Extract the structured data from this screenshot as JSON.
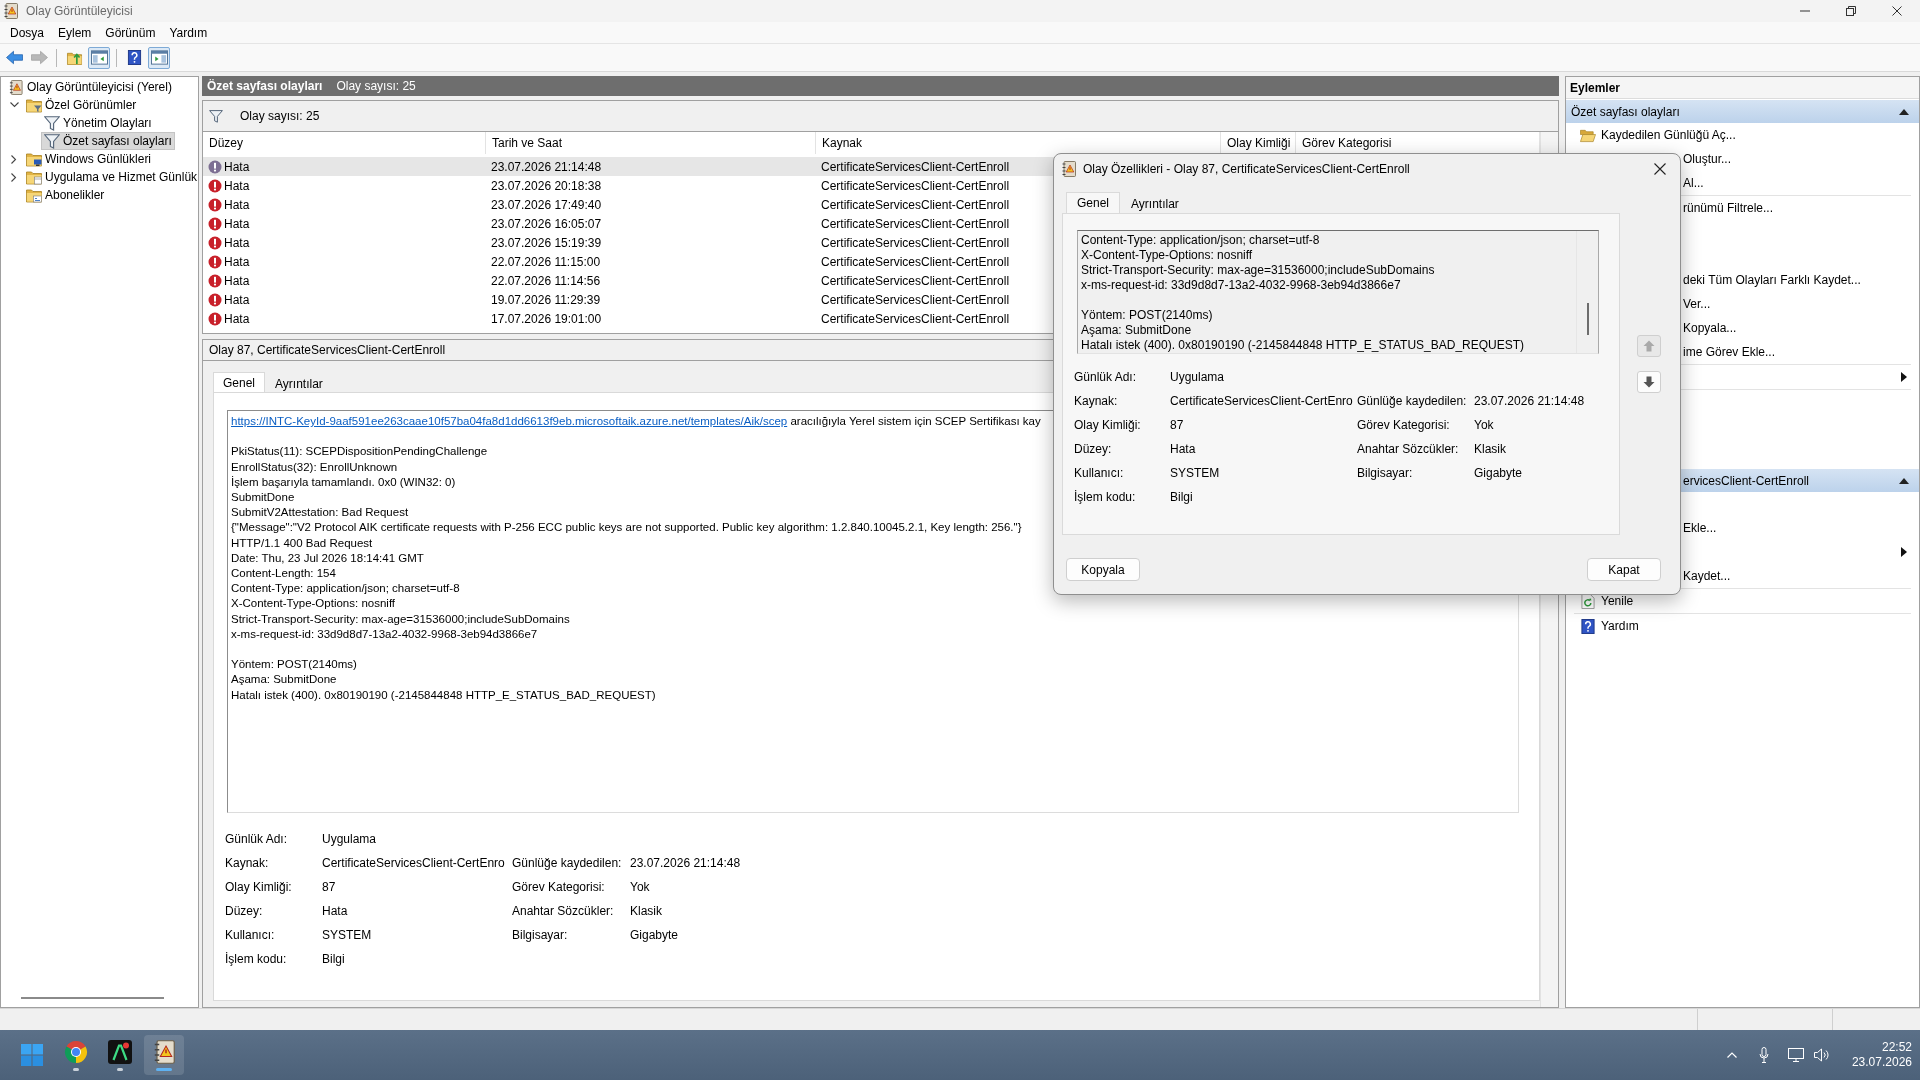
{
  "window": {
    "title": "Olay Görüntüleyicisi"
  },
  "menu": [
    "Dosya",
    "Eylem",
    "Görünüm",
    "Yardım"
  ],
  "toolbar": [
    [
      {
        "kind": "back",
        "disabled": false,
        "pressed": false
      },
      {
        "kind": "forward",
        "disabled": true,
        "pressed": false
      }
    ],
    [
      {
        "kind": "up",
        "disabled": false,
        "pressed": false
      },
      {
        "kind": "tree",
        "disabled": false,
        "pressed": true
      }
    ],
    [
      {
        "kind": "help",
        "disabled": false,
        "pressed": false
      },
      {
        "kind": "pane",
        "disabled": false,
        "pressed": true
      }
    ]
  ],
  "tree": [
    {
      "label": "Olay Görüntüleyicisi (Yerel)",
      "kind": "root",
      "selected": false,
      "children": [
        {
          "label": "Özel Görünümler",
          "kind": "views-folder",
          "expanded": true,
          "selected": false,
          "children": [
            {
              "label": "Yönetim Olayları",
              "kind": "filter",
              "selected": false
            },
            {
              "label": "Özet sayfası olayları",
              "kind": "filter",
              "selected": true
            }
          ]
        },
        {
          "label": "Windows Günlükleri",
          "kind": "logs-folder",
          "expanded": false,
          "selected": false
        },
        {
          "label": "Uygulama ve Hizmet Günlük",
          "kind": "app-folder",
          "expanded": false,
          "selected": false
        },
        {
          "label": "Abonelikler",
          "kind": "subscriptions-folder",
          "selected": false
        }
      ]
    }
  ],
  "center": {
    "title": "Özet sayfası olayları",
    "count": "Olay sayısı: 25",
    "filter_text": "Olay sayısı: 25",
    "table": {
      "columns": [
        "Düzey",
        "Tarih ve Saat",
        "Kaynak",
        "Olay Kimliği",
        "Görev Kategorisi"
      ],
      "rows": [
        {
          "cells": [
            "Hata",
            "23.07.2026 21:14:48",
            "CertificateServicesClient-CertEnroll"
          ],
          "selected": true
        },
        {
          "cells": [
            "Hata",
            "23.07.2026 20:18:38",
            "CertificateServicesClient-CertEnroll"
          ],
          "selected": false
        },
        {
          "cells": [
            "Hata",
            "23.07.2026 17:49:40",
            "CertificateServicesClient-CertEnroll"
          ],
          "selected": false
        },
        {
          "cells": [
            "Hata",
            "23.07.2026 16:05:07",
            "CertificateServicesClient-CertEnroll"
          ],
          "selected": false
        },
        {
          "cells": [
            "Hata",
            "23.07.2026 15:19:39",
            "CertificateServicesClient-CertEnroll"
          ],
          "selected": false
        },
        {
          "cells": [
            "Hata",
            "22.07.2026 11:15:00",
            "CertificateServicesClient-CertEnroll"
          ],
          "selected": false
        },
        {
          "cells": [
            "Hata",
            "22.07.2026 11:14:56",
            "CertificateServicesClient-CertEnroll"
          ],
          "selected": false
        },
        {
          "cells": [
            "Hata",
            "19.07.2026 11:29:39",
            "CertificateServicesClient-CertEnroll"
          ],
          "selected": false
        },
        {
          "cells": [
            "Hata",
            "17.07.2026 19:01:00",
            "CertificateServicesClient-CertEnroll"
          ],
          "selected": false
        }
      ]
    },
    "detail": {
      "title": "Olay 87, CertificateServicesClient-CertEnroll",
      "tabs": [
        {
          "label": "Genel",
          "selected": true
        },
        {
          "label": "Ayrıntılar",
          "selected": false
        }
      ],
      "message": {
        "link": "https://INTC-KeyId-9aaf591ee263caae10f57ba04fa8d1dd6613f9eb.microsoftaik.azure.net/templates/Aik/scep",
        "link_tail": "aracılığıyla Yerel sistem için SCEP Sertifikası kay",
        "blocks": [
          [
            "PkiStatus(11): SCEPDispositionPendingChallenge",
            "EnrollStatus(32): EnrollUnknown",
            "İşlem başarıyla tamamlandı. 0x0 (WIN32: 0)",
            "SubmitDone",
            "SubmitV2Attestation: Bad Request",
            "{\"Message\":\"V2 Protocol AIK certificate requests with P-256 ECC public keys are not supported. Public key algorithm: 1.2.840.10045.2.1, Key length: 256.\"}",
            "HTTP/1.1 400 Bad Request",
            "Date: Thu, 23 Jul 2026 18:14:41 GMT",
            "Content-Length: 154",
            "Content-Type: application/json; charset=utf-8",
            "X-Content-Type-Options: nosniff",
            "Strict-Transport-Security: max-age=31536000;includeSubDomains",
            "x-ms-request-id: 33d9d8d7-13a2-4032-9968-3eb94d3866e7"
          ],
          [
            "Yöntem: POST(2140ms)",
            "Aşama: SubmitDone",
            "Hatalı istek (400). 0x80190190 (-2145844848 HTTP_E_STATUS_BAD_REQUEST)"
          ]
        ]
      },
      "properties": [
        [
          {
            "label": "Günlük Adı:",
            "value": "Uygulama"
          }
        ],
        [
          {
            "label": "Kaynak:",
            "value": "CertificateServicesClient-CertEnro"
          },
          {
            "label": "Günlüğe kaydedilen:",
            "value": "23.07.2026 21:14:48"
          }
        ],
        [
          {
            "label": "Olay Kimliği:",
            "value": "87"
          },
          {
            "label": "Görev Kategorisi:",
            "value": "Yok"
          }
        ],
        [
          {
            "label": "Düzey:",
            "value": "Hata"
          },
          {
            "label": "Anahtar Sözcükler:",
            "value": "Klasik"
          }
        ],
        [
          {
            "label": "Kullanıcı:",
            "value": "SYSTEM"
          },
          {
            "label": "Bilgisayar:",
            "value": "Gigabyte"
          }
        ],
        [
          {
            "label": "İşlem kodu:",
            "value": "Bilgi"
          }
        ]
      ]
    }
  },
  "actions": {
    "title": "Eylemler",
    "sections": [
      {
        "title": "Özet sayfası olayları",
        "kind": "full",
        "expanded": true,
        "groups": [
          [
            {
              "kind": "open-log",
              "label": "Kaydedilen Günlüğü Aç...",
              "submenu": false
            },
            {
              "kind": "cut",
              "label": "Oluştur...",
              "submenu": false
            },
            {
              "kind": "cut",
              "label": "Al...",
              "submenu": false
            }
          ],
          [
            {
              "kind": "cut",
              "label": "rünümü Filtrele...",
              "submenu": false
            },
            {
              "kind": "hidden"
            },
            {
              "kind": "hidden"
            },
            {
              "kind": "cut",
              "label": "deki Tüm Olayları Farklı Kaydet...",
              "submenu": false
            },
            {
              "kind": "cut",
              "label": "Ver...",
              "submenu": false
            },
            {
              "kind": "cut",
              "label": "Kopyala...",
              "submenu": false
            },
            {
              "kind": "cut",
              "label": "ime Görev Ekle...",
              "submenu": false
            }
          ],
          [
            {
              "kind": "hidden",
              "submenu": true
            }
          ],
          [
            {
              "kind": "hidden"
            },
            {
              "kind": "hidden"
            }
          ]
        ]
      },
      {
        "title": "ervicesClient-CertEnroll",
        "kind": "cut",
        "expanded": true,
        "groups": [
          [
            {
              "kind": "hidden"
            },
            {
              "kind": "cut",
              "label": "Ekle...",
              "submenu": false
            },
            {
              "kind": "hidden",
              "submenu": true
            },
            {
              "kind": "cut",
              "label": "Kaydet...",
              "submenu": false
            }
          ],
          [
            {
              "kind": "refresh",
              "label": "Yenile",
              "submenu": false
            }
          ],
          [
            {
              "kind": "help",
              "label": "Yardım",
              "submenu": false
            }
          ]
        ]
      }
    ]
  },
  "dialog": {
    "title": "Olay Özellikleri - Olay 87, CertificateServicesClient-CertEnroll",
    "tabs": [
      {
        "label": "Genel",
        "selected": true
      },
      {
        "label": "Ayrıntılar",
        "selected": false
      }
    ],
    "message": {
      "blocks": [
        [
          "Content-Type: application/json; charset=utf-8",
          "X-Content-Type-Options: nosniff",
          "Strict-Transport-Security: max-age=31536000;includeSubDomains",
          "x-ms-request-id: 33d9d8d7-13a2-4032-9968-3eb94d3866e7"
        ],
        [
          "Yöntem: POST(2140ms)",
          "Aşama: SubmitDone",
          "Hatalı istek (400). 0x80190190 (-2145844848 HTTP_E_STATUS_BAD_REQUEST)"
        ]
      ]
    },
    "properties": [
      [
        {
          "label": "Günlük Adı:",
          "value": "Uygulama"
        }
      ],
      [
        {
          "label": "Kaynak:",
          "value": "CertificateServicesClient-CertEnro"
        },
        {
          "label": "Günlüğe kaydedilen:",
          "value": "23.07.2026 21:14:48"
        }
      ],
      [
        {
          "label": "Olay Kimliği:",
          "value": "87"
        },
        {
          "label": "Görev Kategorisi:",
          "value": "Yok"
        }
      ],
      [
        {
          "label": "Düzey:",
          "value": "Hata"
        },
        {
          "label": "Anahtar Sözcükler:",
          "value": "Klasik"
        }
      ],
      [
        {
          "label": "Kullanıcı:",
          "value": "SYSTEM"
        },
        {
          "label": "Bilgisayar:",
          "value": "Gigabyte"
        }
      ],
      [
        {
          "label": "İşlem kodu:",
          "value": "Bilgi"
        }
      ]
    ],
    "nav_buttons": [
      {
        "kind": "previous",
        "disabled": true
      },
      {
        "kind": "next",
        "disabled": false
      }
    ],
    "buttons": [
      "Kopyala",
      "Kapat"
    ]
  },
  "taskbar": {
    "apps": [
      {
        "kind": "browser",
        "selected": false
      },
      {
        "kind": "dark-app",
        "selected": false
      },
      {
        "kind": "event-viewer",
        "selected": true
      }
    ],
    "time": "22:52",
    "date": "23.07.2026"
  }
}
